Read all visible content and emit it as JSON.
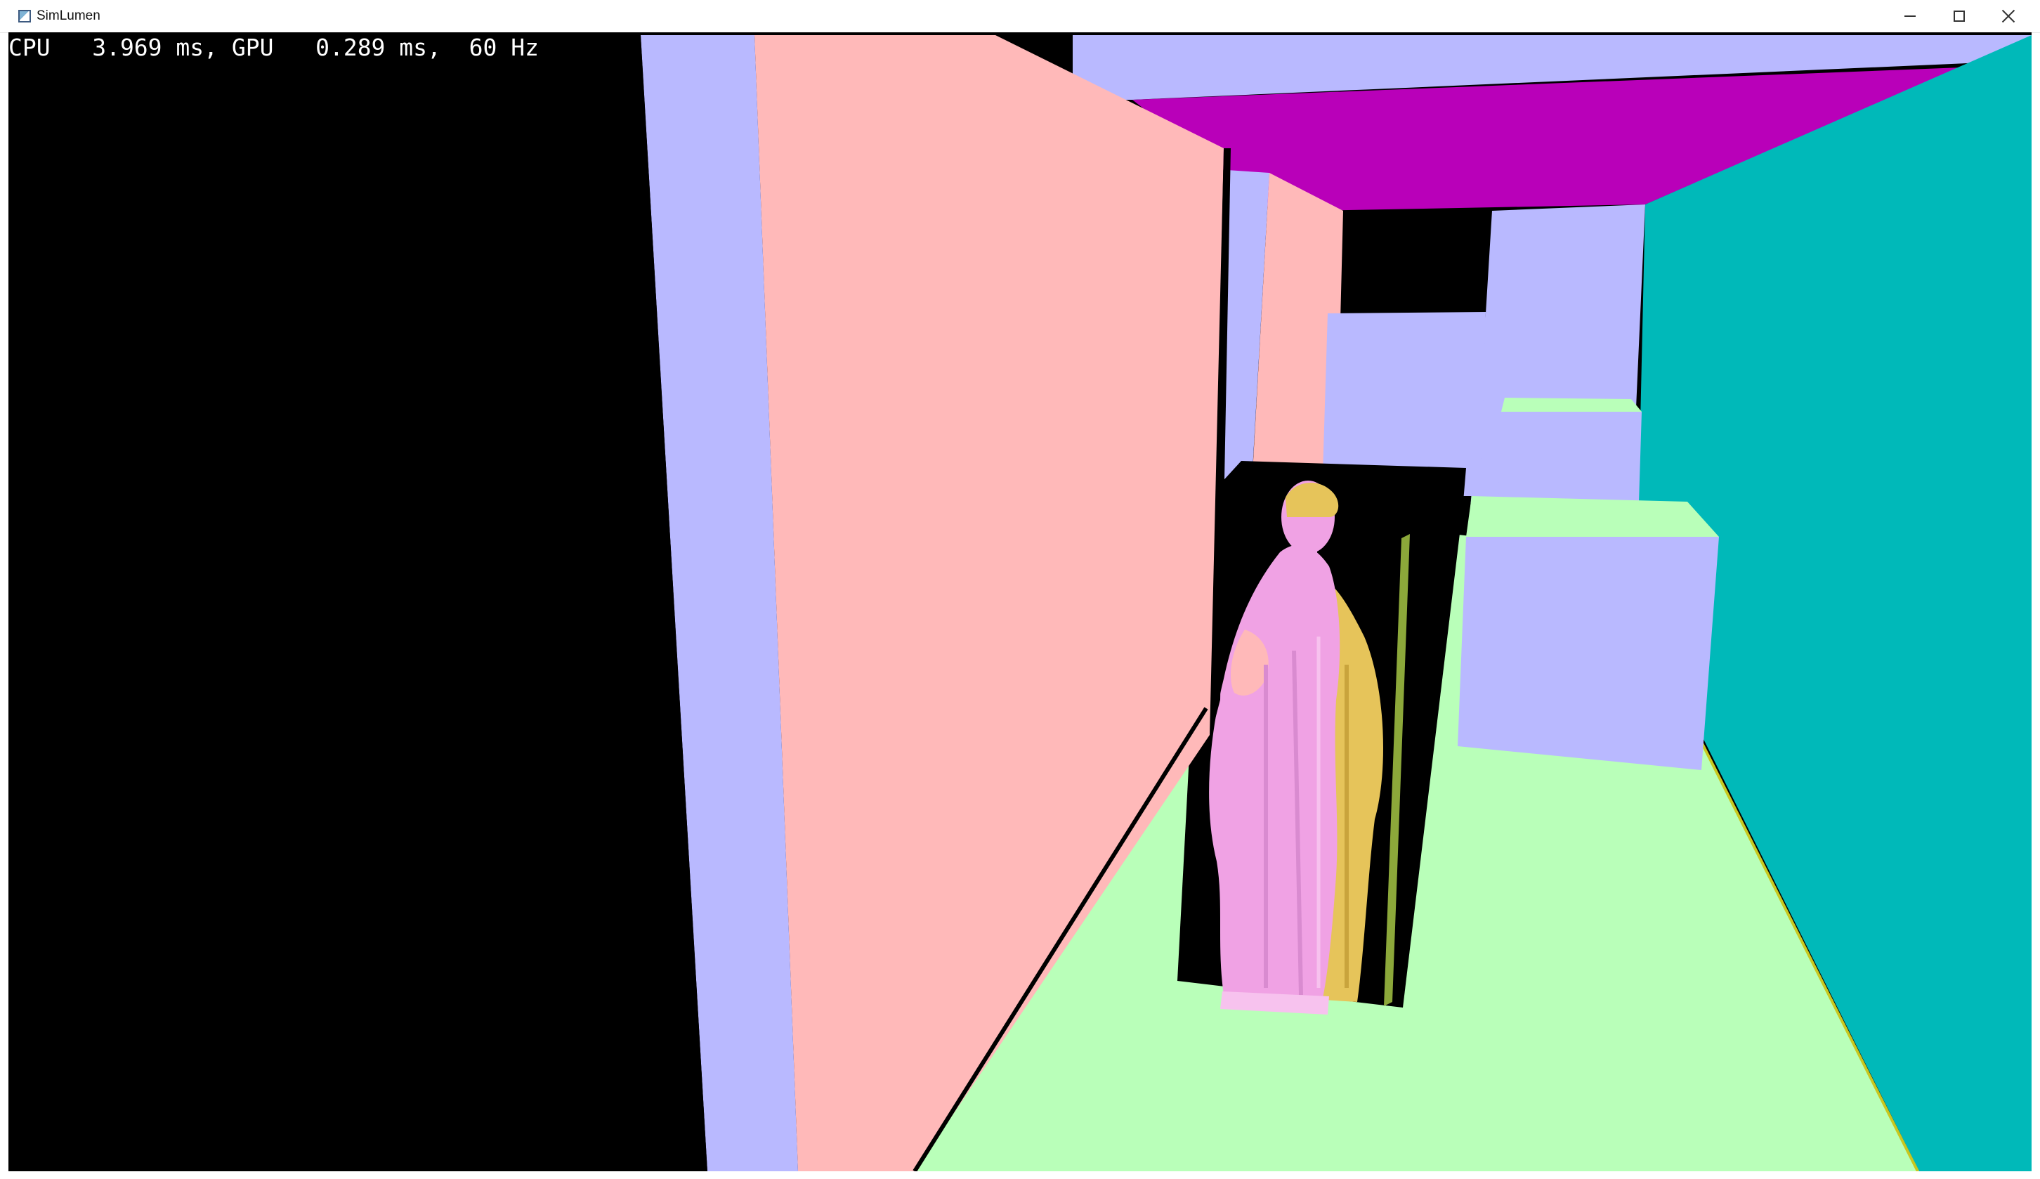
{
  "window": {
    "title": "SimLumen"
  },
  "titlebar_buttons": {
    "minimize_icon": "minimize-icon",
    "maximize_icon": "maximize-icon",
    "close_icon": "close-icon"
  },
  "overlay": {
    "stats_text": "CPU   3.969 ms, GPU   0.289 ms,  60 Hz"
  },
  "scene": {
    "colors": {
      "background": "#000000",
      "wall_lavender": "#b9b9ff",
      "wall_pink": "#ffb9b9",
      "ceiling_magenta": "#b900b9",
      "wall_teal": "#00b9b9",
      "floor_green": "#b9ffb9",
      "statue_pink": "#f0a2e4",
      "statue_yellow": "#e6c45a"
    }
  }
}
